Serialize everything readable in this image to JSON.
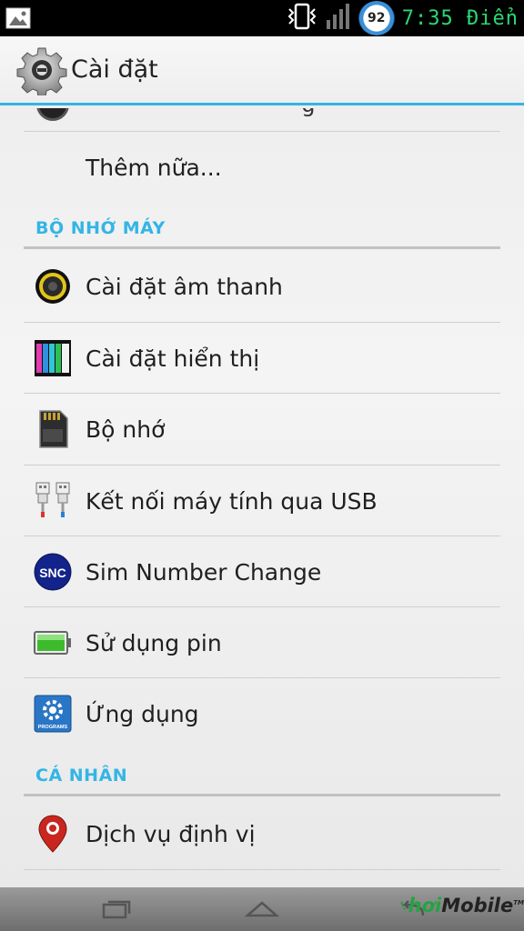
{
  "status_bar": {
    "time_text": "7:35 Điển",
    "badge_value": "92",
    "icons": [
      "image-icon",
      "vibrate-icon",
      "signal-icon",
      "battery-badge-icon"
    ]
  },
  "action_bar": {
    "title": "Cài đặt",
    "icon": "settings-gear-icon"
  },
  "partial_item": {
    "label": "- · - · - · - · - · - · g ·"
  },
  "more_item": {
    "label": "Thêm nữa..."
  },
  "sections": [
    {
      "title": "BỘ NHỚ MÁY",
      "items": [
        {
          "label": "Cài đặt âm thanh",
          "icon": "speaker-icon"
        },
        {
          "label": "Cài đặt hiển thị",
          "icon": "display-bars-icon"
        },
        {
          "label": "Bộ nhớ",
          "icon": "sd-card-icon"
        },
        {
          "label": "Kết nối máy tính qua USB",
          "icon": "usb-icon"
        },
        {
          "label": "Sim Number Change",
          "icon": "snc-icon",
          "icon_text": "SNC"
        },
        {
          "label": "Sử dụng pin",
          "icon": "battery-icon"
        },
        {
          "label": "Ứng dụng",
          "icon": "programs-icon",
          "icon_text": "PROGRAMS"
        }
      ]
    },
    {
      "title": "CÁ NHÂN",
      "items": [
        {
          "label": "Dịch vụ định vị",
          "icon": "location-pin-icon"
        }
      ]
    }
  ],
  "nav_bar": {
    "buttons": [
      "recent-apps-icon",
      "home-icon",
      "back-icon"
    ]
  },
  "watermark": {
    "prefix": "hơi",
    "brand": "Mobile",
    "tm": "TM"
  },
  "colors": {
    "accent": "#33b5e5",
    "status_text": "#2bd872"
  }
}
